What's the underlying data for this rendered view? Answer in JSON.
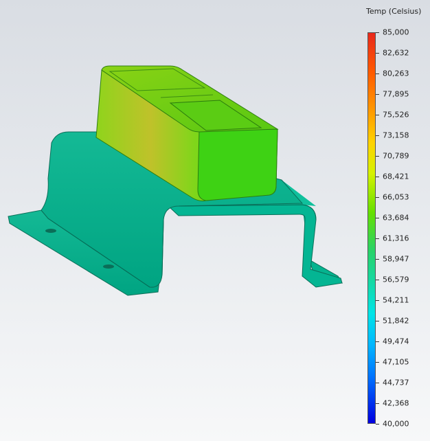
{
  "legend": {
    "title": "Temp (Celsius)",
    "ticks": [
      "85,000",
      "82,632",
      "80,263",
      "77,895",
      "75,526",
      "73,158",
      "70,789",
      "68,421",
      "66,053",
      "63,684",
      "61,316",
      "58,947",
      "56,579",
      "54,211",
      "51,842",
      "49,474",
      "47,105",
      "44,737",
      "42,368",
      "40,000"
    ],
    "max": 85,
    "min": 40
  },
  "colors": {
    "hot": "#e8281c",
    "warm": "#66e000",
    "bracket": "#00b88f",
    "cold": "#0000e0"
  }
}
